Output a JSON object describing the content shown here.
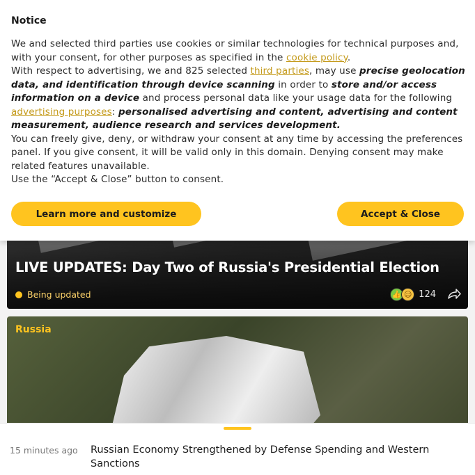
{
  "consent": {
    "title": "Notice",
    "p1_text": "We and selected third parties use cookies or similar technologies for technical purposes and, with your consent, for other purposes as specified in the ",
    "p1_link": "cookie policy",
    "p1_end": ".",
    "p2_a": "With respect to advertising, we and 825 selected ",
    "p2_link1": "third parties",
    "p2_b": ", may use ",
    "p2_bold1": "precise geolocation data, and identification through device scanning",
    "p2_c": " in order to ",
    "p2_bold2": "store and/or access information on a device",
    "p2_d": " and process personal data like your usage data for the following ",
    "p2_link2": "advertising purposes",
    "p2_e": ": ",
    "p2_bold3": "personalised advertising and content, advertising and content measurement, audience research and services development.",
    "p3": "You can freely give, deny, or withdraw your consent at any time by accessing the preferences panel. If you give consent, it will be valid only in this domain. Denying consent may make related features unavailable.",
    "p4": "Use the “Accept & Close” button to consent.",
    "learn_button": "Learn more and customize",
    "accept_button": "Accept & Close"
  },
  "feed": {
    "card1": {
      "title": "LIVE UPDATES: Day Two of Russia's Presidential Election",
      "status": "Being updated",
      "reactions_count": "124",
      "icons": [
        "thumbs-up-icon",
        "smile-icon",
        "share-icon"
      ]
    },
    "card2": {
      "category": "Russia"
    }
  },
  "news_bar": {
    "time": "15 minutes ago",
    "title": "Russian Economy Strengthened by Defense Spending and Western Sanctions"
  },
  "colors": {
    "accent": "#ffc41f",
    "link": "#c49a1a"
  }
}
